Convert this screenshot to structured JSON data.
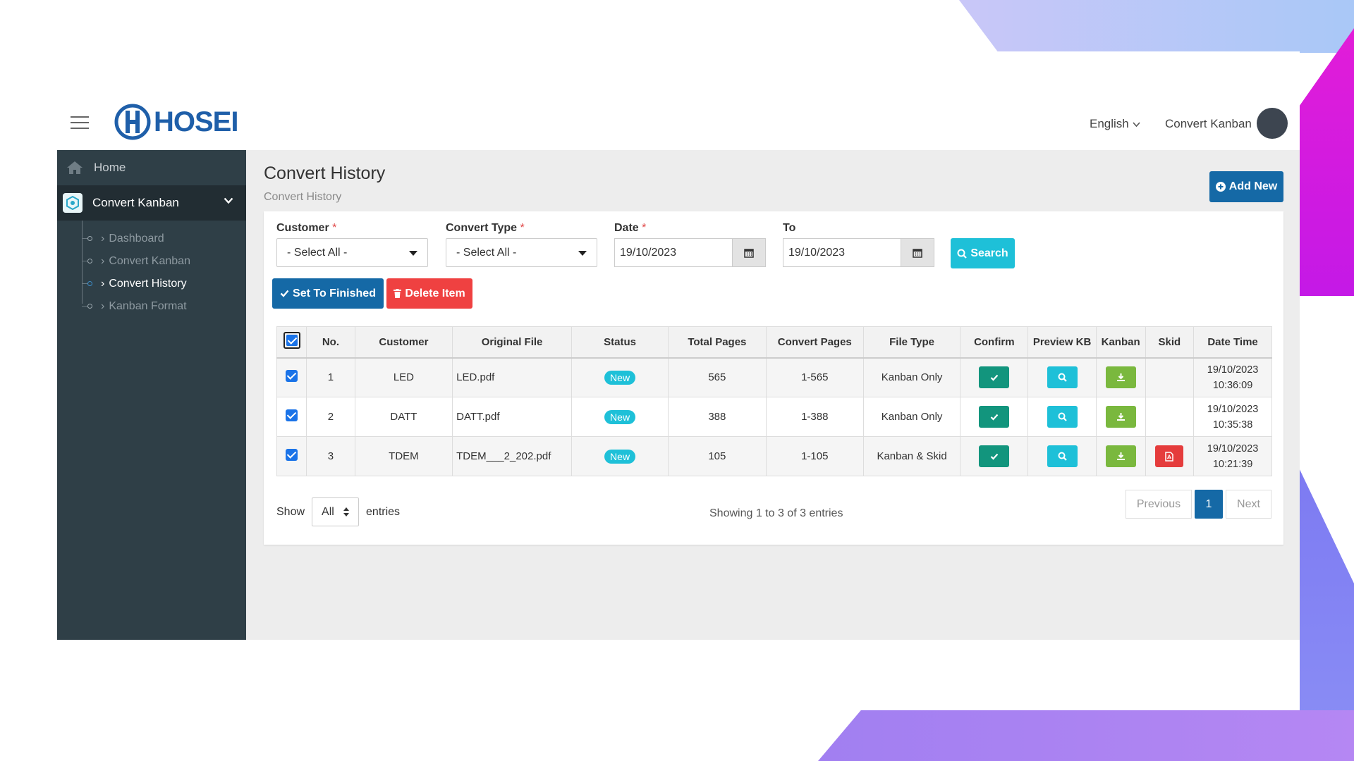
{
  "brand": {
    "name": "HOSEI",
    "color": "#1f5fa9"
  },
  "header": {
    "language": "English",
    "user_label": "Convert Kanban"
  },
  "sidebar": {
    "home": "Home",
    "section": "Convert Kanban",
    "items": [
      {
        "label": "Dashboard",
        "active": false
      },
      {
        "label": "Convert Kanban",
        "active": false
      },
      {
        "label": "Convert History",
        "active": true
      },
      {
        "label": "Kanban Format",
        "active": false
      }
    ]
  },
  "page": {
    "title": "Convert History",
    "breadcrumb": "Convert History",
    "add_button": "Add New"
  },
  "filters": {
    "customer_label": "Customer",
    "customer_value": "- Select All -",
    "convert_type_label": "Convert Type",
    "convert_type_value": "- Select All -",
    "date_label": "Date",
    "date_value": "19/10/2023",
    "to_label": "To",
    "to_value": "19/10/2023",
    "required_mark": "*",
    "search_button": "Search"
  },
  "actions": {
    "set_finished": "Set To Finished",
    "delete_item": "Delete Item"
  },
  "table": {
    "columns": [
      "No.",
      "Customer",
      "Original File",
      "Status",
      "Total Pages",
      "Convert Pages",
      "File Type",
      "Confirm",
      "Preview KB",
      "Kanban",
      "Skid",
      "Date Time"
    ],
    "rows": [
      {
        "no": "1",
        "customer": "LED",
        "file": "LED.pdf",
        "status": "New",
        "total": "565",
        "convert": "1-565",
        "type": "Kanban Only",
        "date": "19/10/2023",
        "time": "10:36:09",
        "skid": false
      },
      {
        "no": "2",
        "customer": "DATT",
        "file": "DATT.pdf",
        "status": "New",
        "total": "388",
        "convert": "1-388",
        "type": "Kanban Only",
        "date": "19/10/2023",
        "time": "10:35:38",
        "skid": false
      },
      {
        "no": "3",
        "customer": "TDEM",
        "file": "TDEM___2_202.pdf",
        "status": "New",
        "total": "105",
        "convert": "1-105",
        "type": "Kanban & Skid",
        "date": "19/10/2023",
        "time": "10:21:39",
        "skid": true
      }
    ]
  },
  "footer": {
    "show": "Show",
    "length_value": "All",
    "entries": "entries",
    "info": "Showing 1 to 3 of 3 entries",
    "previous": "Previous",
    "page": "1",
    "next": "Next"
  },
  "colors": {
    "primary": "#1569a6",
    "info": "#1ec0d8",
    "danger": "#ef4141",
    "success": "#12957d",
    "lime": "#7ab83e",
    "sidebar": "#2f3f47"
  }
}
